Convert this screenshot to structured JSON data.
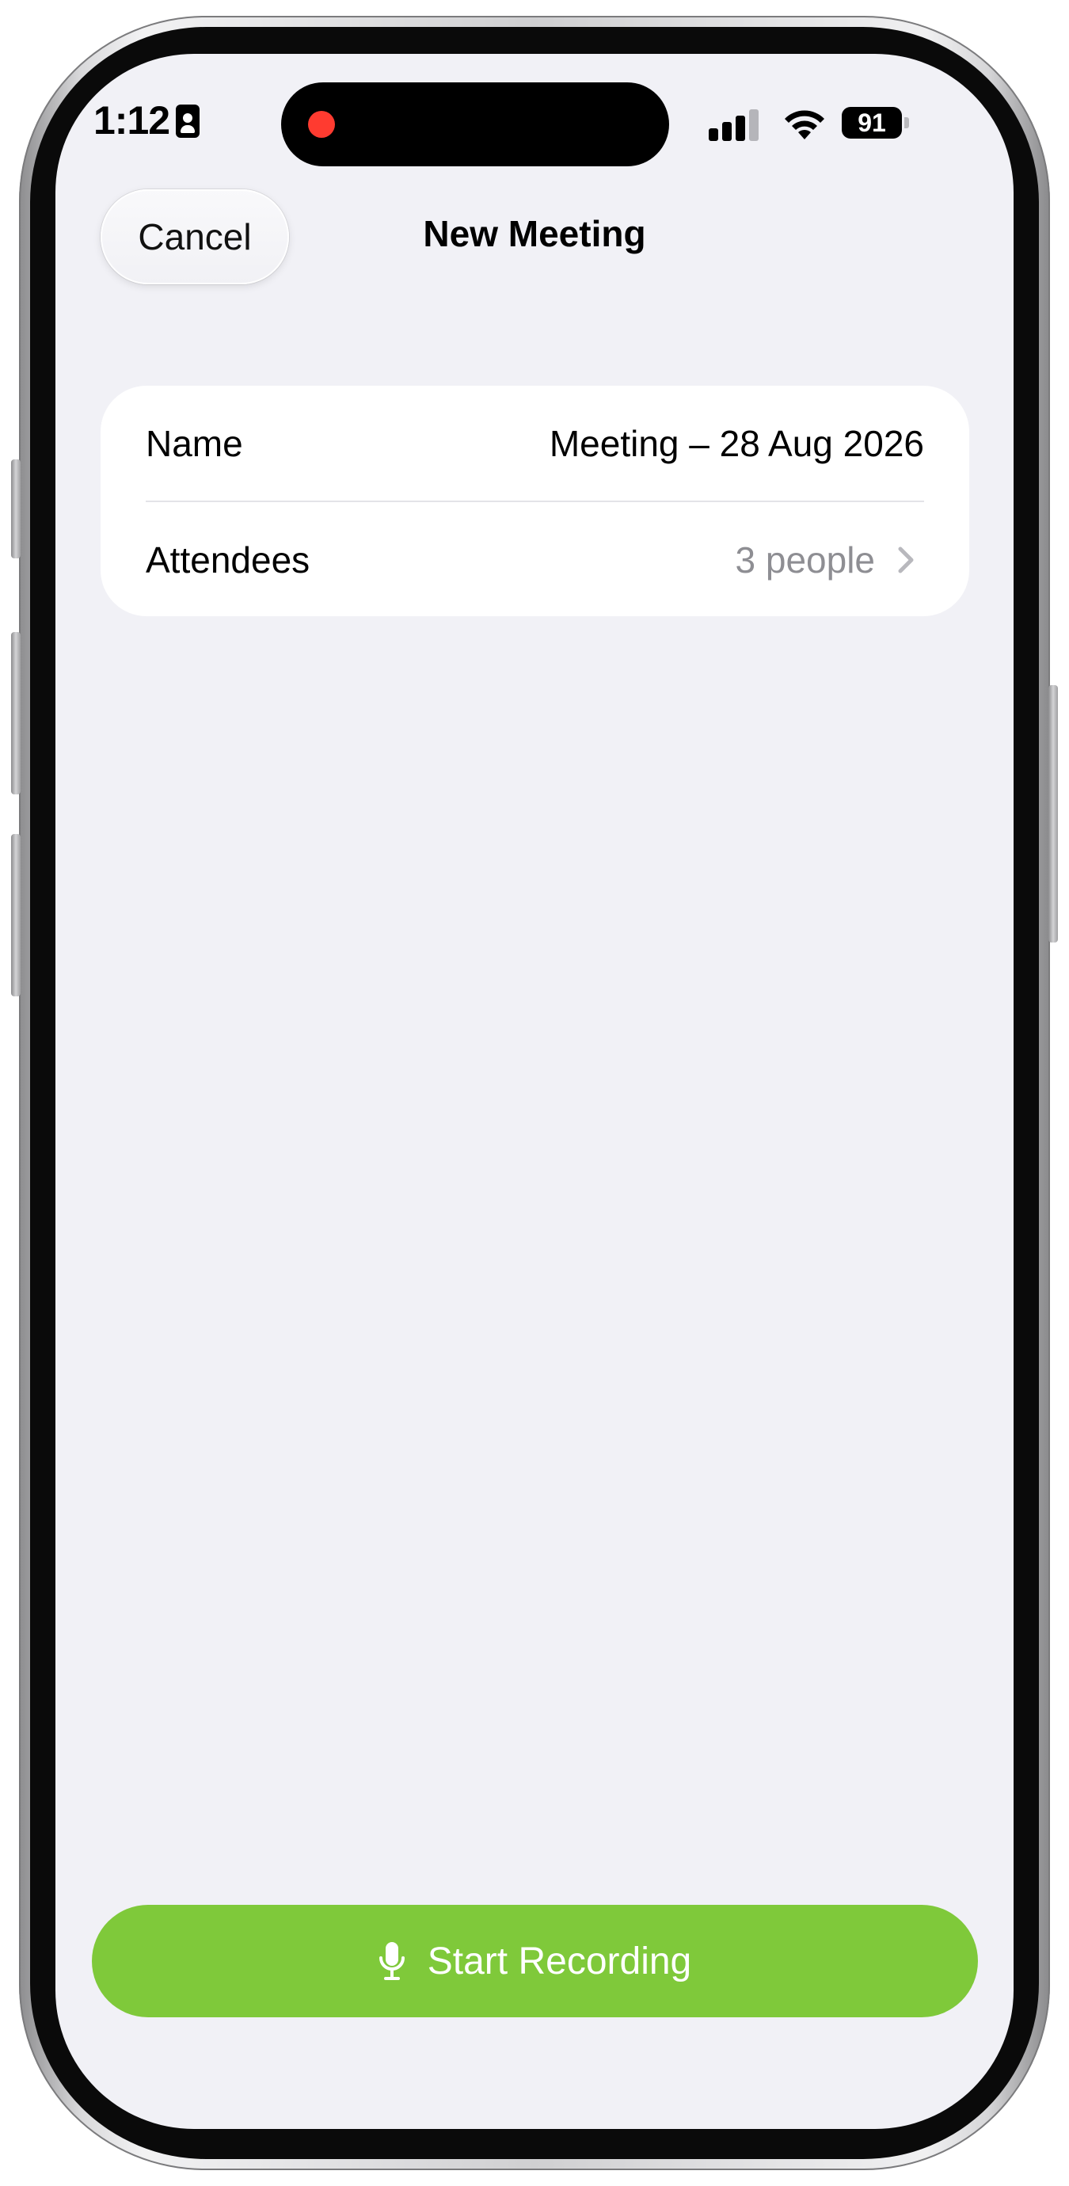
{
  "status_bar": {
    "time": "1:12",
    "battery_level": "91",
    "recording_indicator_color": "#ff3b30"
  },
  "nav": {
    "cancel_label": "Cancel",
    "title": "New Meeting"
  },
  "form": {
    "rows": [
      {
        "label": "Name",
        "value": "Meeting – 28 Aug 2026"
      },
      {
        "label": "Attendees",
        "value": "3 people"
      }
    ]
  },
  "actions": {
    "start_recording_label": "Start Recording",
    "start_recording_color": "#7fc93a"
  },
  "icons": {
    "contact": "contact-card-icon",
    "signal": "cellular-signal-icon",
    "wifi": "wifi-icon",
    "battery": "battery-icon",
    "chevron": "chevron-right-icon",
    "mic": "microphone-icon"
  }
}
